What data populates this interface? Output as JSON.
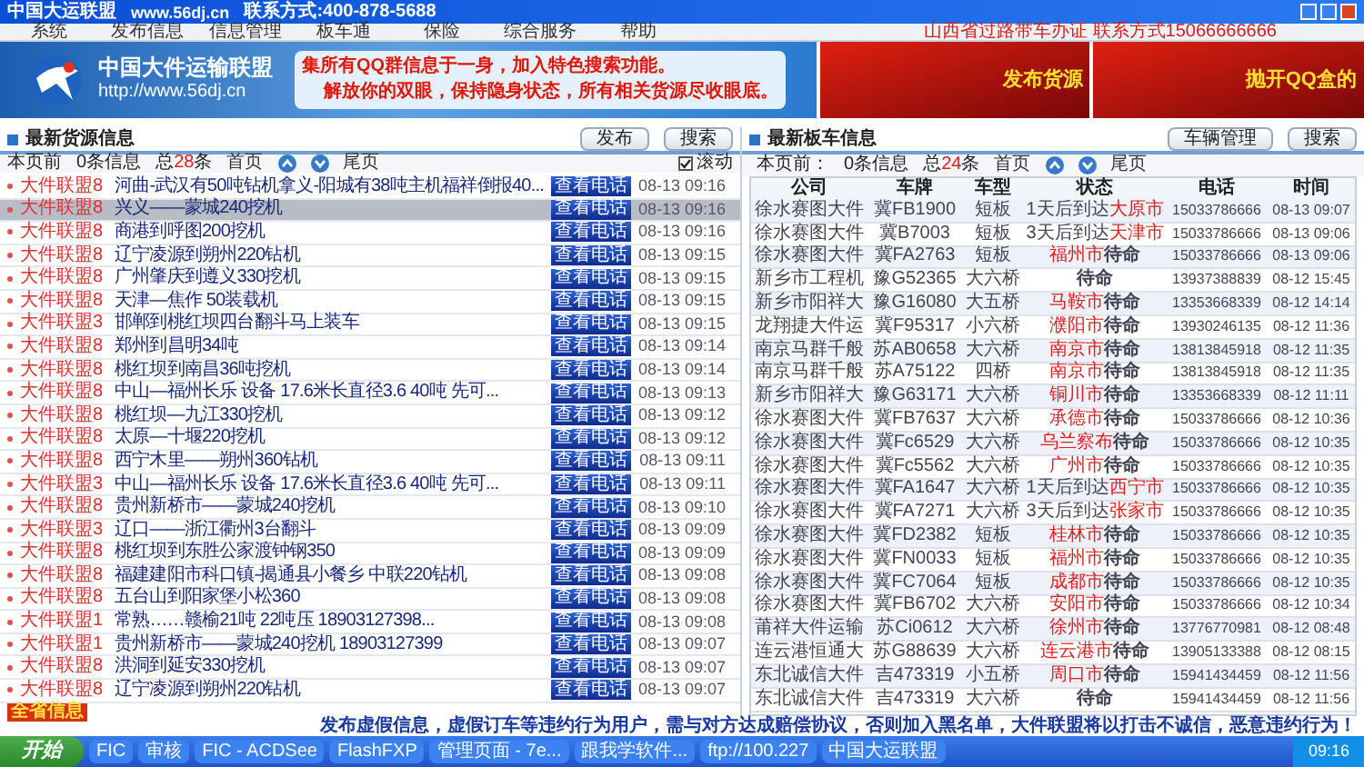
{
  "window": {
    "title": "中国大运联盟",
    "url": "www.56dj.cn",
    "contact": "联系方式:400-878-5688"
  },
  "menu": [
    "系统",
    "发布信息",
    "信息管理",
    "板车通",
    "保险",
    "综合服务",
    "帮助"
  ],
  "notice": "山西省过路带车办证 联系方式15066666666",
  "banner": {
    "logo_title": "中国大件运输联盟",
    "logo_url": "http://www.56dj.cn",
    "line1": "集所有QQ群信息于一身，加入特色搜索功能。",
    "line2": "解放你的双眼，保持隐身状态，所有相关货源尽收眼底。",
    "ads": [
      "发布货源",
      "抛开QQ盒的"
    ]
  },
  "cargo": {
    "title": "最新货源信息",
    "buttons": [
      "发布",
      "搜索"
    ],
    "pager": {
      "label": "本页前",
      "count": "0条信息",
      "total_prefix": "总",
      "total": "28",
      "total_suffix": "条",
      "first": "首页",
      "last": "尾页"
    },
    "scroll": {
      "label": "滚动",
      "checked": true
    },
    "rows": [
      {
        "source": "大件联盟8",
        "text": "河曲-武汉有50吨钻机拿义-阳城有38吨主机福祥倒报40...",
        "action": "查看电话",
        "time": "08-13 09:16",
        "selected": false
      },
      {
        "source": "大件联盟8",
        "text": "兴义——蒙城240挖机",
        "action": "查看电话",
        "time": "08-13 09:16",
        "selected": true
      },
      {
        "source": "大件联盟8",
        "text": "商港到呼图200挖机",
        "action": "查看电话",
        "time": "08-13 09:16",
        "selected": false
      },
      {
        "source": "大件联盟8",
        "text": "辽宁凌源到朔州220钻机",
        "action": "查看电话",
        "time": "08-13 09:15",
        "selected": false
      },
      {
        "source": "大件联盟8",
        "text": "广州肇庆到遵义330挖机",
        "action": "查看电话",
        "time": "08-13 09:15",
        "selected": false
      },
      {
        "source": "大件联盟8",
        "text": "天津—焦作 50装载机",
        "action": "查看电话",
        "time": "08-13 09:15",
        "selected": false
      },
      {
        "source": "大件联盟3",
        "text": "邯郸到桃红坝四台翻斗马上装车",
        "action": "查看电话",
        "time": "08-13 09:15",
        "selected": false
      },
      {
        "source": "大件联盟8",
        "text": "郑州到昌明34吨",
        "action": "查看电话",
        "time": "08-13 09:14",
        "selected": false
      },
      {
        "source": "大件联盟8",
        "text": "桃红坝到南昌36吨挖机",
        "action": "查看电话",
        "time": "08-13 09:14",
        "selected": false
      },
      {
        "source": "大件联盟8",
        "text": "中山—福州长乐 设备 17.6米长直径3.6 40吨 先可...",
        "action": "查看电话",
        "time": "08-13 09:13",
        "selected": false
      },
      {
        "source": "大件联盟8",
        "text": "桃红坝—九江330挖机",
        "action": "查看电话",
        "time": "08-13 09:12",
        "selected": false
      },
      {
        "source": "大件联盟8",
        "text": "太原—十堰220挖机",
        "action": "查看电话",
        "time": "08-13 09:12",
        "selected": false
      },
      {
        "source": "大件联盟8",
        "text": "西宁木里——朔州360钻机",
        "action": "查看电话",
        "time": "08-13 09:11",
        "selected": false
      },
      {
        "source": "大件联盟3",
        "text": "中山—福州长乐 设备 17.6米长直径3.6 40吨 先可...",
        "action": "查看电话",
        "time": "08-13 09:11",
        "selected": false
      },
      {
        "source": "大件联盟8",
        "text": "贵州新桥市——蒙城240挖机",
        "action": "查看电话",
        "time": "08-13 09:10",
        "selected": false
      },
      {
        "source": "大件联盟3",
        "text": "辽口——浙江衢州3台翻斗",
        "action": "查看电话",
        "time": "08-13 09:09",
        "selected": false
      },
      {
        "source": "大件联盟8",
        "text": "桃红坝到东胜公家渡钟钢350",
        "action": "查看电话",
        "time": "08-13 09:09",
        "selected": false
      },
      {
        "source": "大件联盟8",
        "text": "福建建阳市科口镇-揭通县小餐乡 中联220钻机",
        "action": "查看电话",
        "time": "08-13 09:08",
        "selected": false
      },
      {
        "source": "大件联盟8",
        "text": "五台山到阳家堡小松360",
        "action": "查看电话",
        "time": "08-13 09:08",
        "selected": false
      },
      {
        "source": "大件联盟1",
        "text": "常熟……赣榆21吨 22吨压 18903127398...",
        "action": "查看电话",
        "time": "08-13 09:08",
        "selected": false
      },
      {
        "source": "大件联盟1",
        "text": "贵州新桥市——蒙城240挖机 18903127399",
        "action": "查看电话",
        "time": "08-13 09:07",
        "selected": false
      },
      {
        "source": "大件联盟8",
        "text": "洪洞到延安330挖机",
        "action": "查看电话",
        "time": "08-13 09:07",
        "selected": false
      },
      {
        "source": "大件联盟8",
        "text": "辽宁凌源到朔州220钻机",
        "action": "查看电话",
        "time": "08-13 09:07",
        "selected": false
      }
    ],
    "footer_tag": "全省信息"
  },
  "trucks": {
    "title": "最新板车信息",
    "buttons": [
      "车辆管理",
      "搜索"
    ],
    "pager": {
      "label": "本页前：",
      "count": "0条信息",
      "total_prefix": "总",
      "total": "24",
      "total_suffix": "条",
      "first": "首页",
      "last": "尾页"
    },
    "columns": [
      "公司",
      "车牌",
      "车型",
      "状态",
      "电话",
      "时间"
    ],
    "rows": [
      {
        "company": "徐水赛图大件",
        "plate": "冀FB1900",
        "type": "短板",
        "status": {
          "before": "1天后到达",
          "city": "大原市"
        },
        "phone": "15033786666",
        "time": "08-13 09:07"
      },
      {
        "company": "徐水赛图大件",
        "plate": "冀B7003",
        "type": "短板",
        "status": {
          "before": "3天后到达",
          "city": "天津市"
        },
        "phone": "15033786666",
        "time": "08-13 09:06"
      },
      {
        "company": "徐水赛图大件",
        "plate": "冀FA2763",
        "type": "短板",
        "status": {
          "city": "福州市",
          "after": "待命"
        },
        "phone": "15033786666",
        "time": "08-13 09:06"
      },
      {
        "company": "新乡市工程机",
        "plate": "豫G52365",
        "type": "大六桥",
        "status": {
          "after": "待命"
        },
        "phone": "13937388839",
        "time": "08-12 15:45"
      },
      {
        "company": "新乡市阳祥大",
        "plate": "豫G16080",
        "type": "大五桥",
        "status": {
          "city": "马鞍市",
          "after": "待命"
        },
        "phone": "13353668339",
        "time": "08-12 14:14"
      },
      {
        "company": "龙翔捷大件运",
        "plate": "冀F95317",
        "type": "小六桥",
        "status": {
          "city": "濮阳市",
          "after": "待命"
        },
        "phone": "13930246135",
        "time": "08-12 11:36"
      },
      {
        "company": "南京马群千般",
        "plate": "苏AB0658",
        "type": "大六桥",
        "status": {
          "city": "南京市",
          "after": "待命"
        },
        "phone": "13813845918",
        "time": "08-12 11:35"
      },
      {
        "company": "南京马群千般",
        "plate": "苏A75122",
        "type": "四桥",
        "status": {
          "city": "南京市",
          "after": "待命"
        },
        "phone": "13813845918",
        "time": "08-12 11:35"
      },
      {
        "company": "新乡市阳祥大",
        "plate": "豫G63171",
        "type": "大六桥",
        "status": {
          "city": "铜川市",
          "after": "待命"
        },
        "phone": "13353668339",
        "time": "08-12 11:11"
      },
      {
        "company": "徐水赛图大件",
        "plate": "冀FB7637",
        "type": "大六桥",
        "status": {
          "city": "承德市",
          "after": "待命"
        },
        "phone": "15033786666",
        "time": "08-12 10:36"
      },
      {
        "company": "徐水赛图大件",
        "plate": "冀Fc6529",
        "type": "大六桥",
        "status": {
          "city": "乌兰察布",
          "after": "待命"
        },
        "phone": "15033786666",
        "time": "08-12 10:35"
      },
      {
        "company": "徐水赛图大件",
        "plate": "冀Fc5562",
        "type": "大六桥",
        "status": {
          "city": "广州市",
          "after": "待命"
        },
        "phone": "15033786666",
        "time": "08-12 10:35"
      },
      {
        "company": "徐水赛图大件",
        "plate": "冀FA1647",
        "type": "大六桥",
        "status": {
          "before": "1天后到达",
          "city": "西宁市"
        },
        "phone": "15033786666",
        "time": "08-12 10:35"
      },
      {
        "company": "徐水赛图大件",
        "plate": "冀FA7271",
        "type": "大六桥",
        "status": {
          "before": "3天后到达",
          "city": "张家市"
        },
        "phone": "15033786666",
        "time": "08-12 10:35"
      },
      {
        "company": "徐水赛图大件",
        "plate": "冀FD2382",
        "type": "短板",
        "status": {
          "city": "桂林市",
          "after": "待命"
        },
        "phone": "15033786666",
        "time": "08-12 10:35"
      },
      {
        "company": "徐水赛图大件",
        "plate": "冀FN0033",
        "type": "短板",
        "status": {
          "city": "福州市",
          "after": "待命"
        },
        "phone": "15033786666",
        "time": "08-12 10:35"
      },
      {
        "company": "徐水赛图大件",
        "plate": "冀FC7064",
        "type": "短板",
        "status": {
          "city": "成都市",
          "after": "待命"
        },
        "phone": "15033786666",
        "time": "08-12 10:35"
      },
      {
        "company": "徐水赛图大件",
        "plate": "冀FB6702",
        "type": "大六桥",
        "status": {
          "city": "安阳市",
          "after": "待命"
        },
        "phone": "15033786666",
        "time": "08-12 10:34"
      },
      {
        "company": "莆祥大件运输",
        "plate": "苏Ci0612",
        "type": "大六桥",
        "status": {
          "city": "徐州市",
          "after": "待命"
        },
        "phone": "13776770981",
        "time": "08-12 08:48"
      },
      {
        "company": "连云港恒通大",
        "plate": "苏G88639",
        "type": "大六桥",
        "status": {
          "city": "连云港市",
          "after": "待命"
        },
        "phone": "13905133388",
        "time": "08-12 08:15"
      },
      {
        "company": "东北诚信大件",
        "plate": "吉473319",
        "type": "小五桥",
        "status": {
          "city": "周口市",
          "after": "待命"
        },
        "phone": "15941434459",
        "time": "08-12 11:56"
      },
      {
        "company": "东北诚信大件",
        "plate": "吉473319",
        "type": "大六桥",
        "status": {
          "after": "待命"
        },
        "phone": "15941434459",
        "time": "08-12 11:56"
      }
    ]
  },
  "marquee": "发布虚假信息，虚假订车等违约行为用户，需与对方达成赔偿协议，否则加入黑名单，大件联盟将以打击不诚信，恶意违约行为！",
  "taskbar": {
    "start": "开始",
    "items": [
      "FIC",
      "审核",
      "FIC - ACDSee",
      "FlashFXP",
      "管理页面 - 7e...",
      "跟我学软件...",
      "ftp://100.227",
      "中国大运联盟"
    ],
    "clock": "09:16"
  }
}
